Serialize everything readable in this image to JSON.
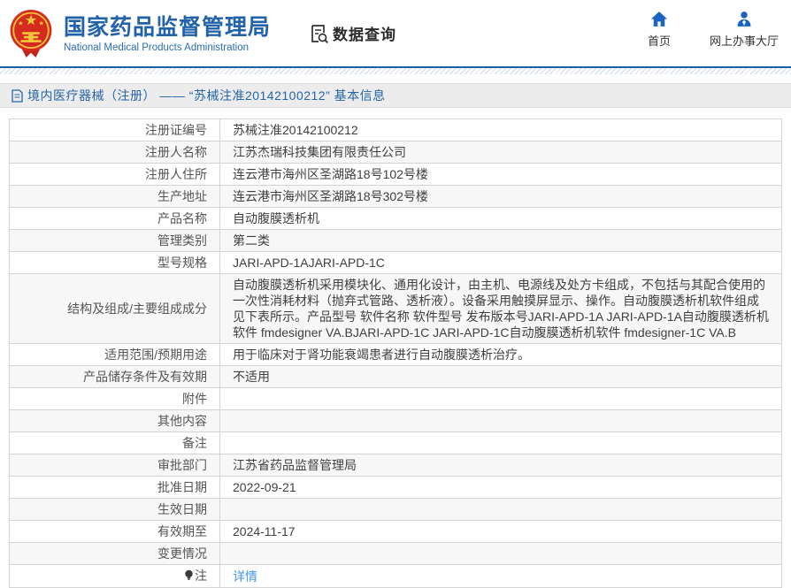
{
  "header": {
    "site_title": "国家药品监督管理局",
    "site_subtitle": "National Medical Products Administration",
    "section_label": "数据查询",
    "nav": {
      "home": "首页",
      "service_hall": "网上办事大厅"
    }
  },
  "breadcrumb": {
    "text": "境内医疗器械（注册） —— “苏械注准20142100212” 基本信息"
  },
  "colors": {
    "brand_blue": "#2262aa",
    "divider_blue": "#1d5fa9",
    "link_blue": "#4596e6",
    "emblem_red": "#d42b1e",
    "emblem_gold": "#f5c63c",
    "row_alt_bg": "#f7f7f7"
  },
  "table": {
    "rows": [
      {
        "label": "注册证编号",
        "value": "苏械注准20142100212"
      },
      {
        "label": "注册人名称",
        "value": "江苏杰瑞科技集团有限责任公司"
      },
      {
        "label": "注册人住所",
        "value": "连云港市海州区圣湖路18号102号楼"
      },
      {
        "label": "生产地址",
        "value": "连云港市海州区圣湖路18号302号楼"
      },
      {
        "label": "产品名称",
        "value": "自动腹膜透析机"
      },
      {
        "label": "管理类别",
        "value": "第二类"
      },
      {
        "label": "型号规格",
        "value": "JARI-APD-1AJARI-APD-1C"
      },
      {
        "label": "结构及组成/主要组成成分",
        "value": "自动腹膜透析机采用模块化、通用化设计，由主机、电源线及处方卡组成，不包括与其配合使用的一次性消耗材料（抛弃式管路、透析液）。设备采用触摸屏显示、操作。自动腹膜透析机软件组成见下表所示。产品型号 软件名称 软件型号 发布版本号JARI-APD-1A JARI-APD-1A自动腹膜透析机软件 fmdesigner VA.BJARI-APD-1C JARI-APD-1C自动腹膜透析机软件 fmdesigner-1C VA.B"
      },
      {
        "label": "适用范围/预期用途",
        "value": "用于临床对于肾功能衰竭患者进行自动腹膜透析治疗。"
      },
      {
        "label": "产品储存条件及有效期",
        "value": "不适用"
      },
      {
        "label": "附件",
        "value": ""
      },
      {
        "label": "其他内容",
        "value": ""
      },
      {
        "label": "备注",
        "value": ""
      },
      {
        "label": "审批部门",
        "value": "江苏省药品监督管理局"
      },
      {
        "label": "批准日期",
        "value": "2022-09-21"
      },
      {
        "label": "生效日期",
        "value": ""
      },
      {
        "label": "有效期至",
        "value": "2024-11-17"
      },
      {
        "label": "变更情况",
        "value": ""
      },
      {
        "label": "注",
        "icon": "note-bulb-icon",
        "value": "详情",
        "value_is_link": true
      }
    ]
  }
}
